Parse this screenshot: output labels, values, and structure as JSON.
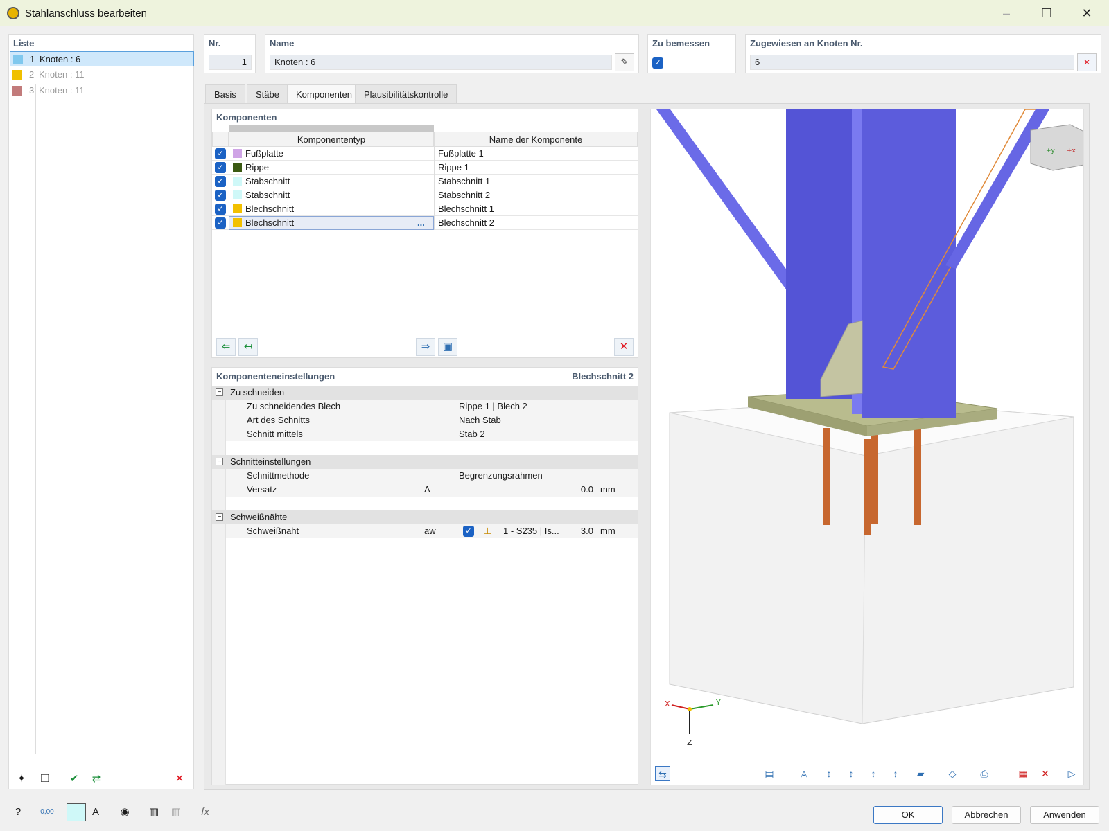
{
  "window": {
    "title": "Stahlanschluss bearbeiten"
  },
  "list": {
    "header": "Liste",
    "items": [
      {
        "num": "1",
        "label": "Knoten : 6",
        "color": "#7fc8ee",
        "selected": true
      },
      {
        "num": "2",
        "label": "Knoten : 11",
        "color": "#f0c000",
        "selected": false
      },
      {
        "num": "3",
        "label": "Knoten : 11",
        "color": "#c27b7b",
        "selected": false
      }
    ]
  },
  "header_fields": {
    "nr_label": "Nr.",
    "nr_value": "1",
    "name_label": "Name",
    "name_value": "Knoten : 6",
    "design_label": "Zu bemessen",
    "assigned_label": "Zugewiesen an Knoten Nr.",
    "assigned_value": "6"
  },
  "tabs": [
    "Basis",
    "Stäbe",
    "Komponenten",
    "Plausibilitätskontrolle"
  ],
  "active_tab": "Komponenten",
  "components": {
    "header": "Komponenten",
    "col_type": "Komponententyp",
    "col_name": "Name der Komponente",
    "rows": [
      {
        "type": "Fußplatte",
        "name": "Fußplatte 1",
        "color": "#cfa4e6"
      },
      {
        "type": "Rippe",
        "name": "Rippe 1",
        "color": "#3b5a12"
      },
      {
        "type": "Stabschnitt",
        "name": "Stabschnitt 1",
        "color": "#cff8f8"
      },
      {
        "type": "Stabschnitt",
        "name": "Stabschnitt 2",
        "color": "#cff8f8"
      },
      {
        "type": "Blechschnitt",
        "name": "Blechschnitt 1",
        "color": "#f2c000"
      },
      {
        "type": "Blechschnitt",
        "name": "Blechschnitt 2",
        "color": "#f2c000"
      }
    ],
    "selected_row_more": "..."
  },
  "settings": {
    "header": "Komponenteneinstellungen",
    "current": "Blechschnitt 2",
    "sections": [
      {
        "title": "Zu schneiden",
        "rows": [
          {
            "label": "Zu schneidendes Blech",
            "symbol": "",
            "value": "Rippe 1 | Blech 2",
            "unit": ""
          },
          {
            "label": "Art des Schnitts",
            "symbol": "",
            "value": "Nach Stab",
            "unit": ""
          },
          {
            "label": "Schnitt mittels",
            "symbol": "",
            "value": "Stab 2",
            "unit": ""
          }
        ]
      },
      {
        "title": "Schnitteinstellungen",
        "rows": [
          {
            "label": "Schnittmethode",
            "symbol": "",
            "value": "Begrenzungsrahmen",
            "unit": ""
          },
          {
            "label": "Versatz",
            "symbol": "Δ",
            "value": "0.0",
            "unit": "mm"
          }
        ]
      },
      {
        "title": "Schweißnähte",
        "rows": [
          {
            "label": "Schweißnaht",
            "symbol": "aw",
            "value": "3.0",
            "unit": "mm",
            "material": "1 - S235 | Is..."
          }
        ]
      }
    ]
  },
  "axes": {
    "x": "X",
    "y": "Y",
    "z": "Z"
  },
  "cube": {
    "y": "+y",
    "x": "+x"
  },
  "buttons": {
    "ok": "OK",
    "cancel": "Abbrechen",
    "apply": "Anwenden"
  },
  "status": {
    "value_icon": "0,00"
  }
}
